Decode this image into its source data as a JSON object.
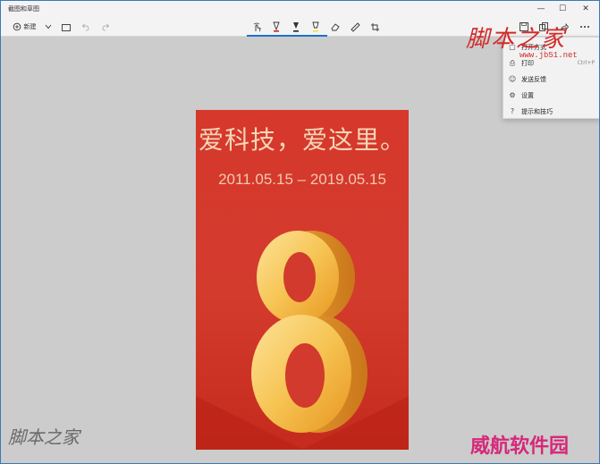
{
  "app": {
    "title": "截图和草图"
  },
  "window_controls": {
    "minimize": "—",
    "maximize": "☐",
    "close": "✕"
  },
  "toolbar": {
    "new_label": "新建"
  },
  "menu": {
    "items": [
      {
        "label": "打开方式",
        "shortcut": "",
        "icon": "open-with-icon"
      },
      {
        "label": "打印",
        "shortcut": "Ctrl+P",
        "icon": "print-icon"
      },
      {
        "label": "发送反馈",
        "shortcut": "",
        "icon": "feedback-icon"
      },
      {
        "label": "设置",
        "shortcut": "",
        "icon": "gear-icon"
      },
      {
        "label": "提示和技巧",
        "shortcut": "",
        "icon": "help-icon"
      }
    ]
  },
  "poster": {
    "slogan": "爱科技，爱这里。",
    "dates": "2011.05.15 – 2019.05.15",
    "numeral": "8"
  },
  "watermarks": {
    "top_right": "脚本之家",
    "url": "www.jb51.net",
    "bottom_left": "脚本之家",
    "bottom_right": "威航软件园"
  },
  "colors": {
    "accent": "#1a73c8",
    "poster_red": "#d33b2d",
    "gold": "#f6c453"
  }
}
